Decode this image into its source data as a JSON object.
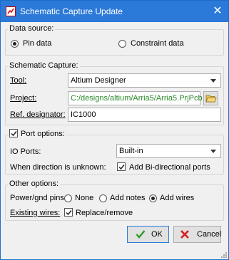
{
  "window": {
    "title": "Schematic Capture Update",
    "close_glyph": "✕"
  },
  "data_source": {
    "label": "Data source:",
    "options": [
      {
        "label": "Pin data",
        "selected": true
      },
      {
        "label": "Constraint data",
        "selected": false
      }
    ]
  },
  "schematic_capture": {
    "label": "Schematic Capture:",
    "tool_label": "Tool:",
    "tool_value": "Altium Designer",
    "project_label": "Project:",
    "project_value": "C:/designs/altium/Arria5/Arria5.PrjPcb",
    "ref_label": "Ref. designator:",
    "ref_value": "IC1000"
  },
  "port_options": {
    "label": "Port options:",
    "checked": true,
    "io_ports_label": "IO Ports:",
    "io_ports_value": "Built-in",
    "unknown_dir_label": "When direction is unknown:",
    "bidir_label": "Add Bi-directional ports",
    "bidir_checked": true
  },
  "other_options": {
    "label": "Other options:",
    "power_label": "Power/gnd pins:",
    "power_options": [
      {
        "label": "None",
        "selected": false
      },
      {
        "label": "Add notes",
        "selected": false
      },
      {
        "label": "Add wires",
        "selected": true
      }
    ],
    "existing_label": "Existing wires:",
    "replace_label": "Replace/remove",
    "replace_checked": true
  },
  "buttons": {
    "ok": "OK",
    "cancel": "Cancel"
  },
  "colors": {
    "titlebar": "#2b79d8",
    "path_text": "#2a8a2a",
    "ok_icon": "#2e9a2e",
    "cancel_icon": "#d42020"
  }
}
